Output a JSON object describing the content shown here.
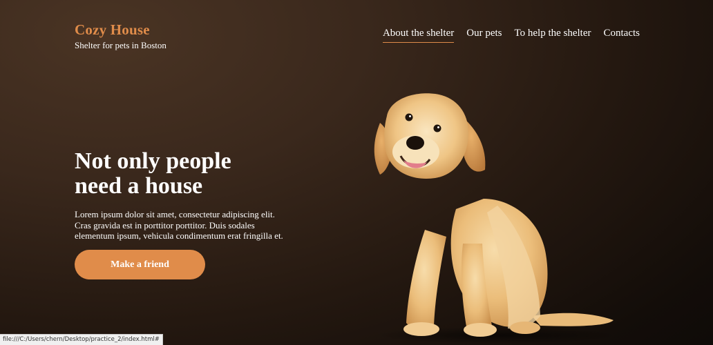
{
  "brand": {
    "title": "Cozy House",
    "subtitle": "Shelter for pets in Boston",
    "accent_color": "#e08c4a"
  },
  "nav": {
    "items": [
      {
        "label": "About the shelter",
        "active": true
      },
      {
        "label": "Our pets",
        "active": false
      },
      {
        "label": "To help the shelter",
        "active": false
      },
      {
        "label": "Contacts",
        "active": false
      }
    ]
  },
  "hero": {
    "headline_line1": "Not only people",
    "headline_line2": "need a house",
    "body": "Lorem ipsum dolor sit amet, consectetur adipiscing elit. Cras gravida est in porttitor porttitor. Duis sodales elementum ipsum, vehicula condimentum erat fringilla et.",
    "cta_label": "Make a friend",
    "image_icon": "puppy-illustration"
  },
  "status_bar": {
    "url": "file:///C:/Users/chern/Desktop/practice_2/index.html#"
  }
}
